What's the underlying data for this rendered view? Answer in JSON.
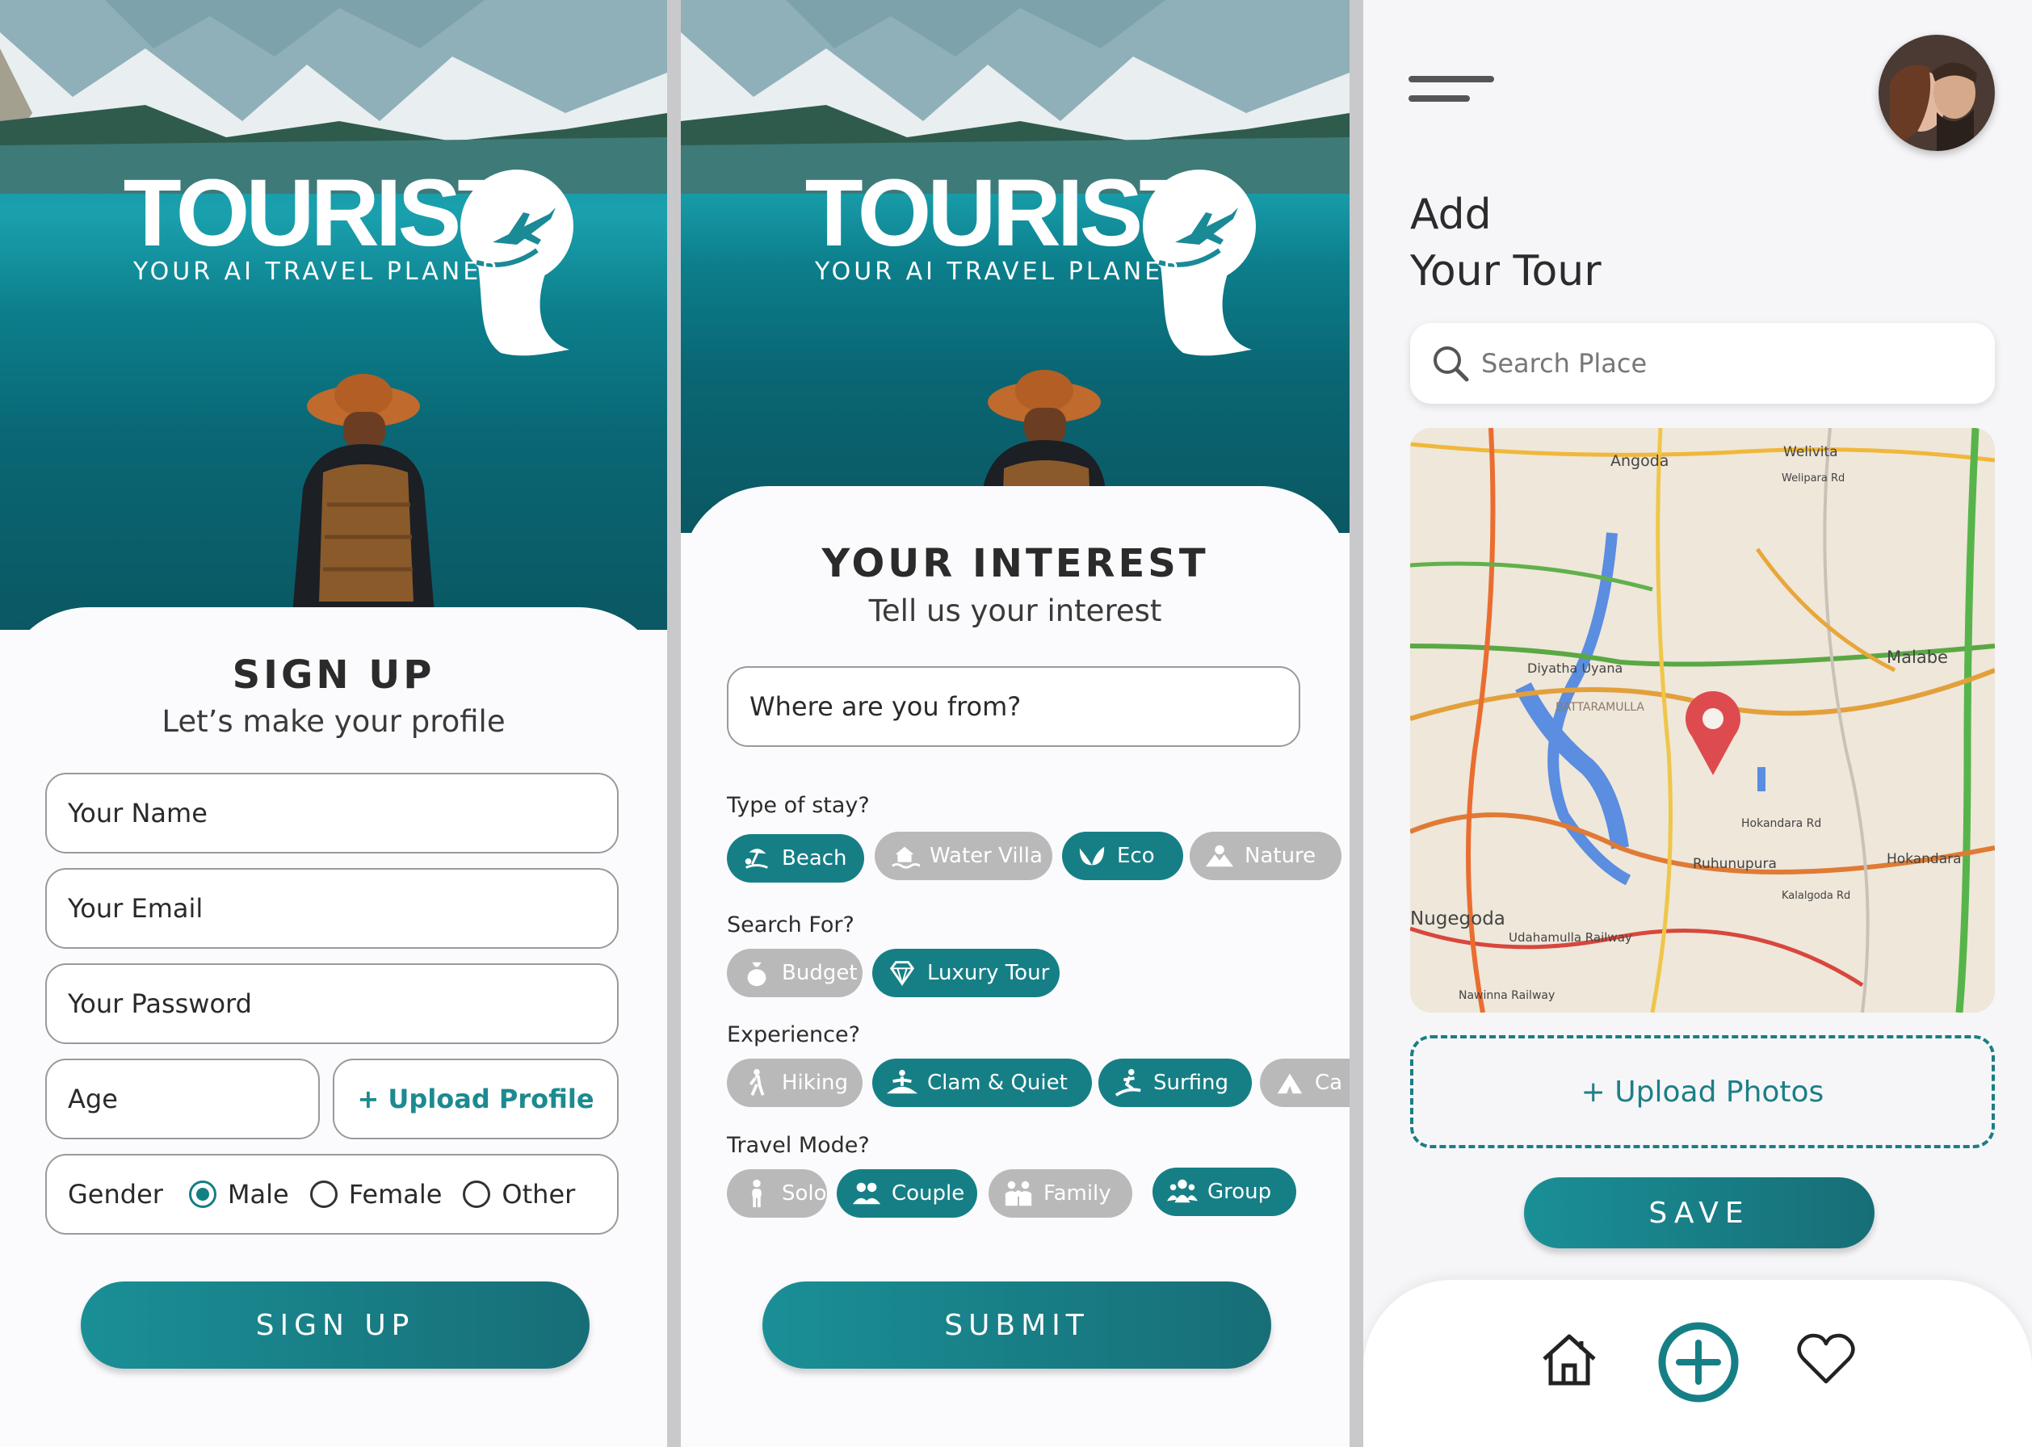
{
  "brand": {
    "name": "TOURIST",
    "tagline": "YOUR AI TRAVEL PLANER",
    "accent": "#167f86"
  },
  "signup": {
    "title": "SIGN UP",
    "subtitle": "Let’s make your profile",
    "name_placeholder": "Your Name",
    "email_placeholder": "Your Email",
    "password_placeholder": "Your Password",
    "age_placeholder": "Age",
    "upload_profile_label": "+ Upload Profile",
    "gender_label": "Gender",
    "gender_options": [
      "Male",
      "Female",
      "Other"
    ],
    "gender_selected": "Male",
    "submit_label": "SIGN UP"
  },
  "interest": {
    "title": "YOUR INTEREST",
    "subtitle": "Tell us your interest",
    "origin_placeholder": "Where are you from?",
    "stay_label": "Type of stay?",
    "stay_options": [
      {
        "label": "Beach",
        "icon": "beach-icon",
        "selected": true
      },
      {
        "label": "Water Villa",
        "icon": "water-villa-icon",
        "selected": false
      },
      {
        "label": "Eco",
        "icon": "leaf-icon",
        "selected": true
      },
      {
        "label": "Nature",
        "icon": "mountain-sun-icon",
        "selected": false
      }
    ],
    "search_label": "Search For?",
    "search_options": [
      {
        "label": "Budget",
        "icon": "money-bag-icon",
        "selected": false
      },
      {
        "label": "Luxury Tour",
        "icon": "diamond-icon",
        "selected": true
      }
    ],
    "experience_label": "Experience?",
    "experience_options": [
      {
        "label": "Hiking",
        "icon": "hiking-icon",
        "selected": false
      },
      {
        "label": "Clam & Quiet",
        "icon": "meditation-icon",
        "selected": true
      },
      {
        "label": "Surfing",
        "icon": "surfing-icon",
        "selected": true
      },
      {
        "label": "Ca",
        "icon": "tent-icon",
        "selected": false
      }
    ],
    "travel_label": "Travel Mode?",
    "travel_options": [
      {
        "label": "Solo",
        "icon": "person-icon",
        "selected": false
      },
      {
        "label": "Couple",
        "icon": "couple-icon",
        "selected": true
      },
      {
        "label": "Family",
        "icon": "family-icon",
        "selected": false
      },
      {
        "label": "Group",
        "icon": "group-icon",
        "selected": true
      }
    ],
    "submit_label": "SUBMIT"
  },
  "add_tour": {
    "title_line1": "Add",
    "title_line2": "Your Tour",
    "search_placeholder": "Search Place",
    "map_labels": [
      "Angoda",
      "Welivita",
      "Welipara Rd",
      "Diyatha Uyana",
      "BATTARAMULLA",
      "Malabe",
      "Hokandara Rd",
      "Hokandara",
      "Ruhunupura",
      "Kalalgoda Rd",
      "Nugegoda",
      "Udahamulla Railway",
      "Nawinna Railway"
    ],
    "upload_label": "+ Upload Photos",
    "save_label": "SAVE"
  },
  "nav": {
    "items": [
      "home-icon",
      "add-circle-icon",
      "heart-icon"
    ]
  }
}
